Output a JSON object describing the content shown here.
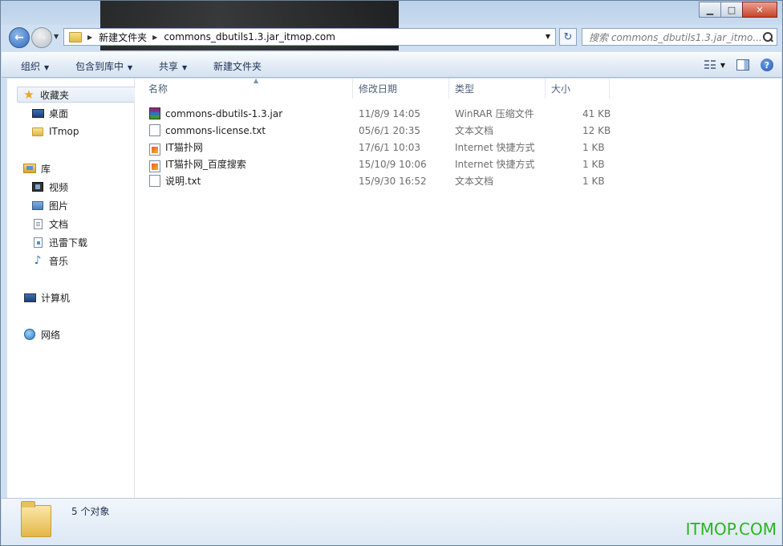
{
  "window": {
    "controls": {
      "minimize": "▁",
      "maximize": "□",
      "close": "✕"
    }
  },
  "address": {
    "crumbs": [
      "新建文件夹",
      "commons_dbutils1.3.jar_itmop.com"
    ]
  },
  "search": {
    "placeholder": "搜索 commons_dbutils1.3.jar_itmo..."
  },
  "toolbar": {
    "organize": "组织",
    "include": "包含到库中",
    "share": "共享",
    "new_folder": "新建文件夹"
  },
  "sidebar": {
    "favorites": "收藏夹",
    "desktop": "桌面",
    "itmop": "ITmop",
    "libraries": "库",
    "videos": "视频",
    "pictures": "图片",
    "documents": "文档",
    "thunder": "迅雷下载",
    "music": "音乐",
    "computer": "计算机",
    "network": "网络"
  },
  "columns": {
    "name": "名称",
    "date": "修改日期",
    "type": "类型",
    "size": "大小"
  },
  "files": [
    {
      "name": "commons-dbutils-1.3.jar",
      "date": "11/8/9 14:05",
      "type": "WinRAR 压缩文件",
      "size": "41 KB",
      "icon": "winrar-archive-icon"
    },
    {
      "name": "commons-license.txt",
      "date": "05/6/1 20:35",
      "type": "文本文档",
      "size": "12 KB",
      "icon": "text-file-icon"
    },
    {
      "name": "IT猫扑网",
      "date": "17/6/1 10:03",
      "type": "Internet 快捷方式",
      "size": "1 KB",
      "icon": "internet-shortcut-icon"
    },
    {
      "name": "IT猫扑网_百度搜索",
      "date": "15/10/9 10:06",
      "type": "Internet 快捷方式",
      "size": "1 KB",
      "icon": "internet-shortcut-icon"
    },
    {
      "name": "说明.txt",
      "date": "15/9/30 16:52",
      "type": "文本文档",
      "size": "1 KB",
      "icon": "text-file-icon"
    }
  ],
  "status": {
    "count": "5 个对象"
  },
  "watermark": "ITMOP.COM"
}
